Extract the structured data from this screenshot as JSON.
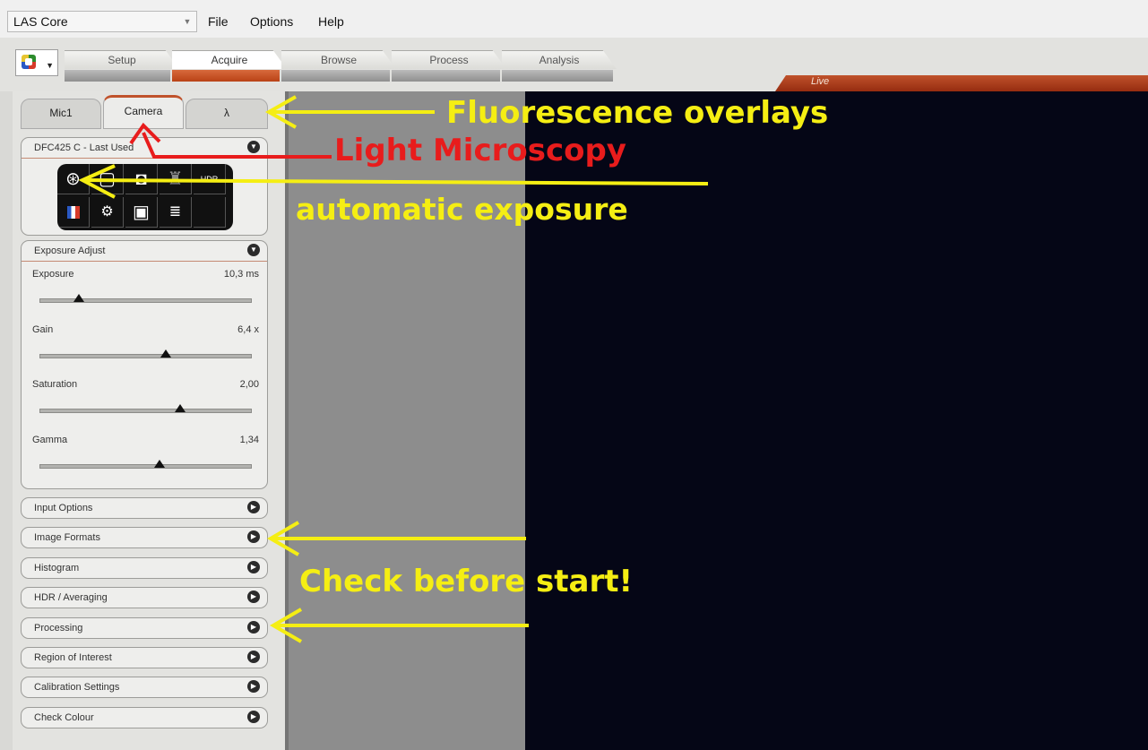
{
  "app": {
    "title": "LAS Core",
    "menus": [
      "File",
      "Options",
      "Help"
    ]
  },
  "workflow_tabs": [
    {
      "label": "Setup",
      "active": false
    },
    {
      "label": "Acquire",
      "active": true
    },
    {
      "label": "Browse",
      "active": false
    },
    {
      "label": "Process",
      "active": false
    },
    {
      "label": "Analysis",
      "active": false
    }
  ],
  "live_label": "Live",
  "panel_tabs": [
    {
      "label": "Mic1",
      "active": false
    },
    {
      "label": "Camera",
      "active": true
    },
    {
      "label": "λ",
      "active": false
    }
  ],
  "camera_group": {
    "title": "DFC425 C - Last Used",
    "icons": [
      "auto-exposure-icon",
      "white-balance-icon",
      "camera-capture-icon",
      "microscope-icon",
      "hdr-icon",
      "color-flag-icon",
      "settings-cog-icon",
      "overlay-icon",
      "list-settings-icon"
    ]
  },
  "exposure_group": {
    "title": "Exposure Adjust",
    "sliders": [
      {
        "label": "Exposure",
        "value": "10,3 ms",
        "position": 0.18
      },
      {
        "label": "Gain",
        "value": "6,4 x",
        "position": 0.59
      },
      {
        "label": "Saturation",
        "value": "2,00",
        "position": 0.66
      },
      {
        "label": "Gamma",
        "value": "1,34",
        "position": 0.56
      }
    ]
  },
  "collapsed_groups": [
    "Input Options",
    "Image Formats",
    "Histogram",
    "HDR / Averaging",
    "Processing",
    "Region of Interest",
    "Calibration Settings",
    "Check Colour"
  ],
  "annotations": {
    "fluorescence": "Fluorescence overlays",
    "light_microscopy": "Light Microscopy",
    "auto_exposure": "automatic exposure",
    "check": "Check before start!"
  },
  "colors": {
    "accent": "#c0522b",
    "annotation_yellow": "#f5ee13",
    "annotation_red": "#e81c1c",
    "live_view": "#050616"
  }
}
